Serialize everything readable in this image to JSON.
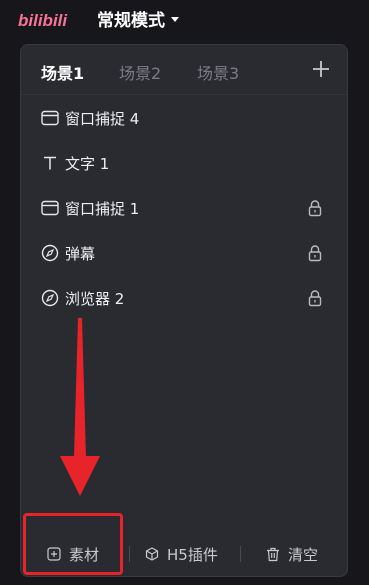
{
  "header": {
    "logo_text": "bilibili",
    "mode_label": "常规模式"
  },
  "scene_tabs": [
    {
      "label": "场景1",
      "active": true
    },
    {
      "label": "场景2",
      "active": false
    },
    {
      "label": "场景3",
      "active": false
    }
  ],
  "sources": [
    {
      "label": "窗口捕捉 4",
      "icon": "window-capture-icon",
      "locked": false
    },
    {
      "label": "文字 1",
      "icon": "text-icon",
      "locked": false
    },
    {
      "label": "窗口捕捉 1",
      "icon": "window-capture-icon",
      "locked": true
    },
    {
      "label": "弹幕",
      "icon": "compass-icon",
      "locked": true
    },
    {
      "label": "浏览器 2",
      "icon": "compass-icon",
      "locked": true
    }
  ],
  "bottom_bar": {
    "material_label": "素材",
    "h5_plugin_label": "H5插件",
    "clear_label": "清空"
  },
  "colors": {
    "brand": "#fb7299",
    "annotation": "#e8242b",
    "panel_bg": "#2a2b30",
    "page_bg": "#16161b"
  }
}
